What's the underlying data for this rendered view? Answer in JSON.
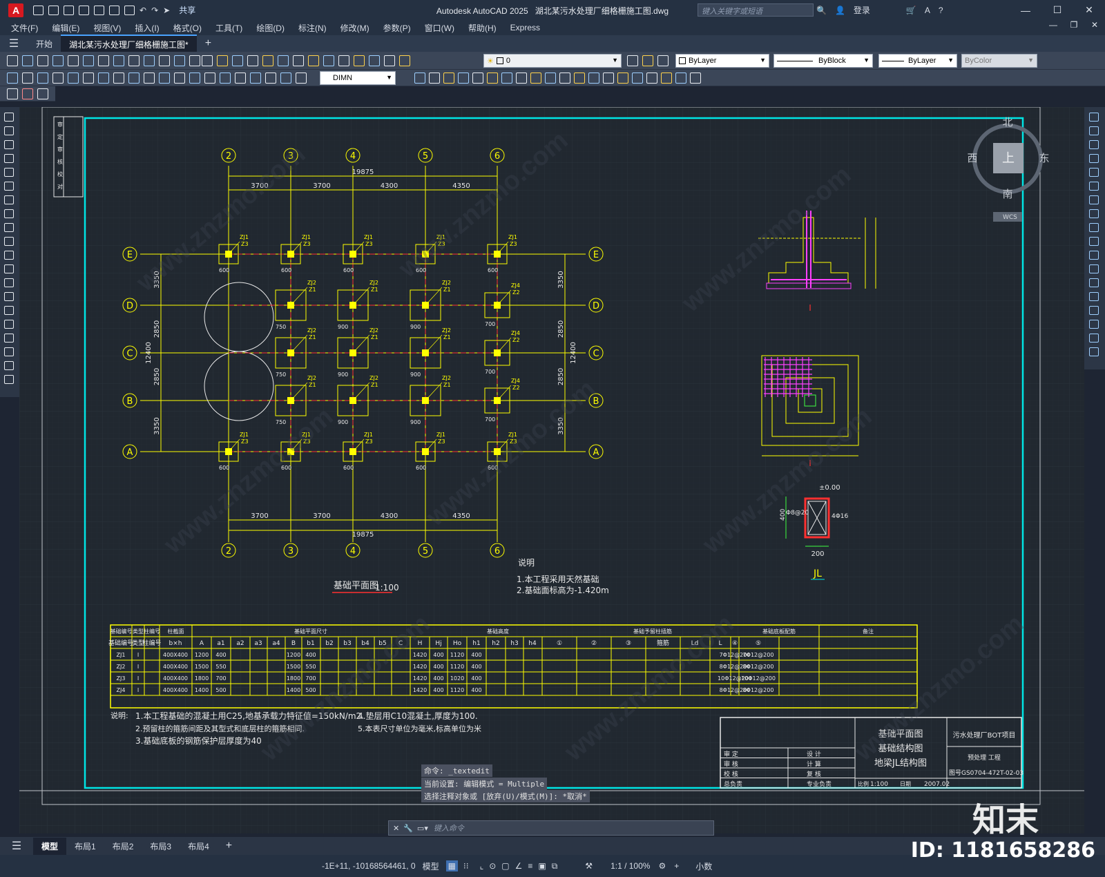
{
  "title": {
    "app": "Autodesk AutoCAD 2025",
    "file": "湖北某污水处理厂细格栅施工图.dwg",
    "search_placeholder": "键入关键字或短语",
    "login": "登录",
    "share": "共享",
    "app_letter": "A"
  },
  "menu": [
    "文件(F)",
    "编辑(E)",
    "视图(V)",
    "插入(I)",
    "格式(O)",
    "工具(T)",
    "绘图(D)",
    "标注(N)",
    "修改(M)",
    "参数(P)",
    "窗口(W)",
    "帮助(H)",
    "Express"
  ],
  "file_tabs": {
    "start": "开始",
    "active": "湖北某污水处理厂细格栅施工图*",
    "add": "+"
  },
  "toolbar": {
    "layer": "0",
    "color": "ByLayer",
    "linetype": "ByBlock",
    "lineweight": "ByLayer",
    "plotstyle": "ByColor",
    "dimstyle": "DIMN"
  },
  "viewcube": {
    "north": "北",
    "south": "南",
    "west": "西",
    "east": "东",
    "top": "上",
    "wcs": "WCS"
  },
  "drawing": {
    "axis_h": [
      "2",
      "3",
      "4",
      "5",
      "6"
    ],
    "axis_v": [
      "E",
      "D",
      "C",
      "B",
      "A"
    ],
    "total_dim": "19875",
    "bay_dims": [
      "3700",
      "3700",
      "4300",
      "4350"
    ],
    "row_dims_left": [
      "3350",
      "2850",
      "2850",
      "3350"
    ],
    "overall_v": "12400",
    "plan_title": "基础平面图",
    "plan_scale": "1:100",
    "notes_title": "说明",
    "notes": [
      "1.本工程采用天然基础",
      "2.基础面标高为-1.420m"
    ],
    "beam_label": "JL",
    "beam_dim_top": "±0.00",
    "beam_dim_h": "400",
    "beam_dim_w": "200",
    "beam_rebar_l": "Φ8@20",
    "beam_rebar_r": "4Φ16",
    "section_mark": "I",
    "left_strip_labels": [
      "审",
      "定",
      "审",
      "核",
      "校",
      "对"
    ],
    "col_tags": [
      "ZJ1",
      "Z3",
      "ZJ2",
      "Z1",
      "ZJ3",
      "ZJ4",
      "Z2"
    ],
    "pad_dims": [
      "600",
      "600",
      "750",
      "900",
      "700"
    ]
  },
  "table": {
    "group_headers": [
      "基础编号",
      "类型",
      "柱编号",
      "柱截面",
      "基础平面尺寸",
      "基础高度",
      "基础予留柱插筋",
      "基础底板配筋",
      "备注"
    ],
    "sub_headers": [
      "基础编号",
      "类型",
      "柱编号",
      "b×h",
      "A",
      "a1",
      "a2",
      "a3",
      "a4",
      "B",
      "b1",
      "b2",
      "b3",
      "b4",
      "b5",
      "C",
      "H",
      "Hj",
      "Ho",
      "h1",
      "h2",
      "h3",
      "h4",
      "①",
      "②",
      "③",
      "箍筋",
      "Ld",
      "L",
      "④",
      "⑤",
      ""
    ],
    "rows": [
      [
        "ZJ1",
        "I",
        "",
        "400X400",
        "1200",
        "400",
        "",
        "",
        "",
        "1200",
        "400",
        "",
        "",
        "",
        "",
        "",
        "1420",
        "400",
        "1120",
        "400",
        "",
        "",
        "",
        "",
        "",
        "",
        "",
        "",
        "",
        "7Φ12@200",
        "7Φ12@200",
        ""
      ],
      [
        "ZJ2",
        "I",
        "",
        "400X400",
        "1500",
        "550",
        "",
        "",
        "",
        "1500",
        "550",
        "",
        "",
        "",
        "",
        "",
        "1420",
        "400",
        "1120",
        "400",
        "",
        "",
        "",
        "",
        "",
        "",
        "",
        "",
        "",
        "8Φ12@200",
        "8Φ12@200",
        ""
      ],
      [
        "ZJ3",
        "I",
        "",
        "400X400",
        "1800",
        "700",
        "",
        "",
        "",
        "1800",
        "700",
        "",
        "",
        "",
        "",
        "",
        "1420",
        "400",
        "1020",
        "400",
        "",
        "",
        "",
        "",
        "",
        "",
        "",
        "",
        "",
        "10Φ12@200",
        "10Φ12@200",
        ""
      ],
      [
        "ZJ4",
        "I",
        "",
        "400X400",
        "1400",
        "500",
        "",
        "",
        "",
        "1400",
        "500",
        "",
        "",
        "",
        "",
        "",
        "1420",
        "400",
        "1120",
        "400",
        "",
        "",
        "",
        "",
        "",
        "",
        "",
        "",
        "",
        "8Φ12@200",
        "8Φ12@200",
        ""
      ]
    ]
  },
  "notes_bottom": {
    "label": "说明:",
    "lines": [
      "1.本工程基础的混凝土用C25,地基承载力特征值=150kN/m2.",
      "2.预留柱的箍筋间距及其型式和底层柱的箍筋相同.",
      "3.基础底板的钢筋保护层厚度为40",
      "4.垫层用C10混凝土,厚度为100.",
      "5.本表尺寸单位为毫米,标高单位为米"
    ]
  },
  "titleblock": {
    "names": [
      "基础平面图",
      "基础结构图",
      "地梁JL结构图"
    ],
    "project": "污水处理厂BOT项目",
    "subproject": "预处理 工程",
    "drawing_no": "图号GS0704-472T-02-03",
    "scale_label": "比例",
    "scale": "1:100",
    "date_label": "日期",
    "date": "2007.02",
    "roles": [
      "审 定",
      "设 计",
      "审 核",
      "计 算",
      "校 核",
      "复 核",
      "总负责",
      "专业负责"
    ]
  },
  "command": {
    "hist1": "命令: _textedit",
    "hist2": "当前设置: 编辑模式 = Multiple",
    "hist3": "选择注释对象或 [放弃(U)/模式(M)]: *取消*",
    "placeholder": "键入命令"
  },
  "layouts": [
    "模型",
    "布局1",
    "布局2",
    "布局3",
    "布局4",
    "+"
  ],
  "status": {
    "coords": "-1E+11, -10168564461, 0",
    "model": "模型",
    "scale": "1:1 / 100%",
    "units": "小数"
  },
  "watermark": {
    "id": "ID: 1181658286",
    "brand": "知末",
    "site": "www.znzmo.com"
  }
}
